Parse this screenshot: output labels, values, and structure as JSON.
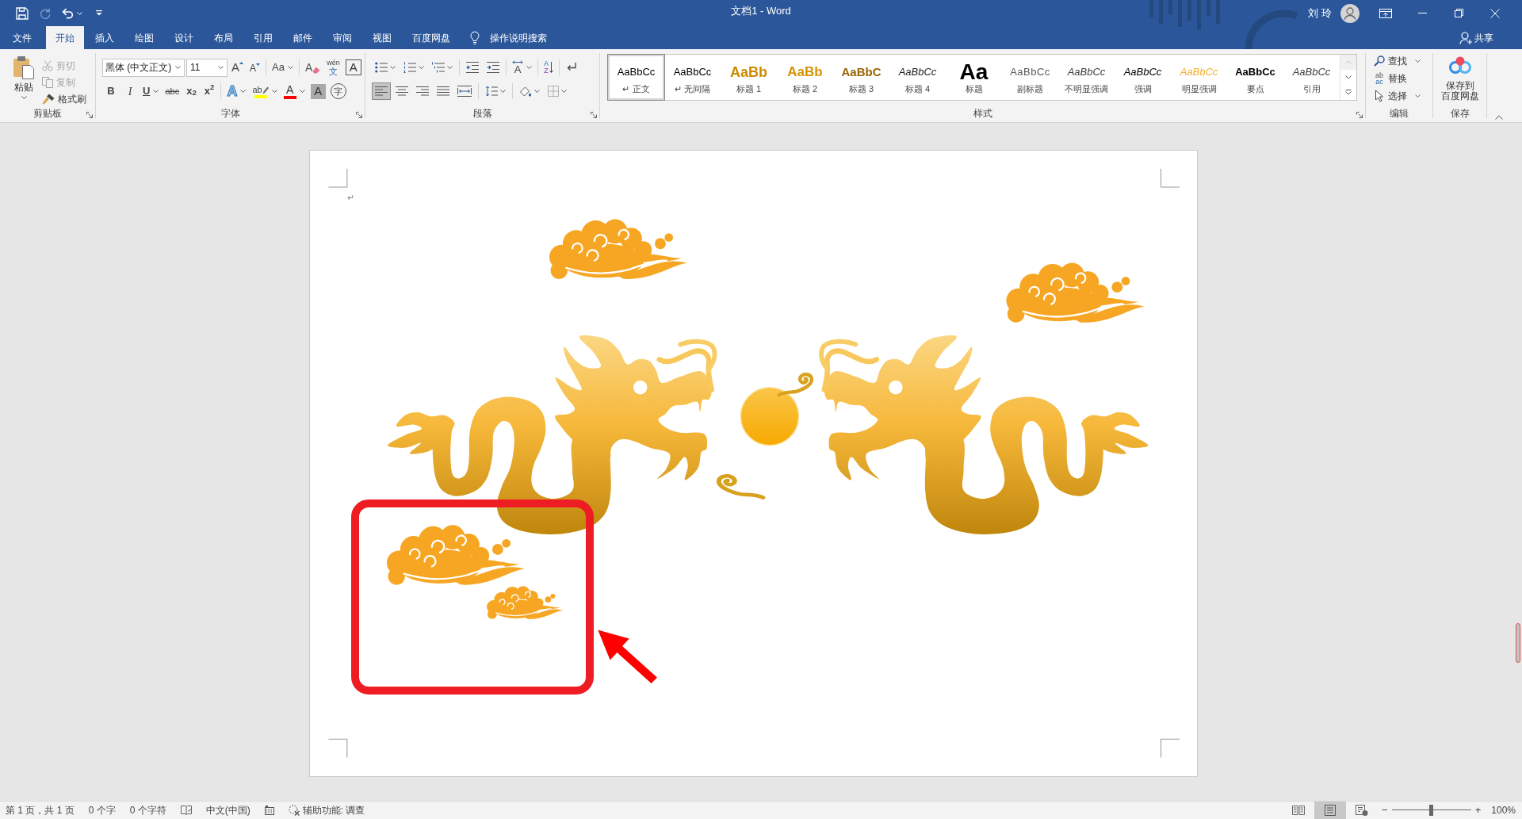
{
  "window": {
    "title": "文档1 - Word",
    "user": "刘 玲"
  },
  "quick_access": [
    {
      "kind": "save",
      "disabled": false
    },
    {
      "kind": "repeat",
      "disabled": true
    },
    {
      "kind": "undo",
      "disabled": false,
      "dropdown": true
    },
    {
      "kind": "customize",
      "disabled": false
    }
  ],
  "tabs": [
    {
      "label": "文件",
      "selected": false
    },
    {
      "label": "开始",
      "selected": true
    },
    {
      "label": "插入",
      "selected": false
    },
    {
      "label": "绘图",
      "selected": false
    },
    {
      "label": "设计",
      "selected": false
    },
    {
      "label": "布局",
      "selected": false
    },
    {
      "label": "引用",
      "selected": false
    },
    {
      "label": "邮件",
      "selected": false
    },
    {
      "label": "审阅",
      "selected": false
    },
    {
      "label": "视图",
      "selected": false
    },
    {
      "label": "百度网盘",
      "selected": false
    }
  ],
  "tell_me": {
    "placeholder": "操作说明搜索"
  },
  "share": {
    "label": "共享"
  },
  "ribbon": {
    "clipboard": {
      "label": "剪贴板",
      "paste": "粘贴",
      "items": [
        {
          "kind": "cut",
          "label": "剪切",
          "disabled": true
        },
        {
          "kind": "copy",
          "label": "复制",
          "disabled": true
        },
        {
          "kind": "format_painter",
          "label": "格式刷",
          "disabled": false
        }
      ]
    },
    "font": {
      "label": "字体",
      "font_name": "黑体 (中文正文)",
      "font_size": "11",
      "row1": [
        [
          {
            "kind": "grow",
            "text": "A"
          },
          {
            "kind": "shrink",
            "text": "A"
          }
        ],
        [
          {
            "kind": "case",
            "text": "Aa",
            "dropdown": true
          }
        ],
        [
          {
            "kind": "clear",
            "text": "A"
          },
          {
            "kind": "phonetic",
            "text": "wén",
            "text2": "文"
          },
          {
            "kind": "border",
            "text": "A"
          }
        ]
      ],
      "row2": [
        [
          {
            "kind": "bold",
            "text": "B"
          },
          {
            "kind": "italic",
            "text": "I"
          },
          {
            "kind": "underline",
            "text": "U",
            "dropdown": true
          },
          {
            "kind": "strike",
            "text": "abc"
          },
          {
            "kind": "subscript",
            "text": "x$_{2}$"
          },
          {
            "kind": "superscript",
            "text": "x$^{2}$"
          }
        ],
        [
          {
            "kind": "effects",
            "text": "A",
            "dropdown": true
          },
          {
            "kind": "highlight",
            "text": "ab",
            "dropdown": true,
            "color": "#ffff00"
          },
          {
            "kind": "color",
            "text": "A",
            "dropdown": true,
            "color": "#ff0000"
          },
          {
            "kind": "shading",
            "text": "A"
          },
          {
            "kind": "enclose",
            "text": "字"
          }
        ]
      ]
    },
    "paragraph": {
      "label": "段落",
      "row1": [
        [
          {
            "kind": "bullets",
            "dropdown": true
          },
          {
            "kind": "numbering",
            "dropdown": true
          },
          {
            "kind": "multilevel",
            "dropdown": true
          }
        ],
        [
          {
            "kind": "outdent"
          },
          {
            "kind": "indent"
          }
        ],
        [
          {
            "kind": "asian_layout",
            "text": "A",
            "dropdown": true
          }
        ],
        [
          {
            "kind": "sort",
            "text": "A",
            "text2": "Z"
          }
        ],
        [
          {
            "kind": "show_marks"
          }
        ]
      ],
      "row2": [
        [
          {
            "kind": "align_left",
            "selected": true
          },
          {
            "kind": "align_center",
            "selected": false
          },
          {
            "kind": "align_right",
            "selected": false
          },
          {
            "kind": "justify",
            "selected": false
          },
          {
            "kind": "distribute",
            "selected": false
          }
        ],
        [
          {
            "kind": "line_spacing",
            "dropdown": true
          }
        ],
        [
          {
            "kind": "shading",
            "dropdown": true
          },
          {
            "kind": "borders",
            "dropdown": true
          }
        ]
      ]
    },
    "styles": {
      "label": "样式",
      "items": [
        {
          "kind": "normal",
          "preview": "AaBbCc",
          "label": "↵ 正文",
          "selected": true
        },
        {
          "kind": "no_spacing",
          "preview": "AaBbCc",
          "label": "↵ 无间隔",
          "selected": false
        },
        {
          "kind": "heading1",
          "preview": "AaBb",
          "label": "标题 1",
          "selected": false
        },
        {
          "kind": "heading2",
          "preview": "AaBb",
          "label": "标题 2",
          "selected": false
        },
        {
          "kind": "heading3",
          "preview": "AaBbC",
          "label": "标题 3",
          "selected": false
        },
        {
          "kind": "heading4",
          "preview": "AaBbCc",
          "label": "标题 4",
          "selected": false
        },
        {
          "kind": "title",
          "preview": "Aa",
          "label": "标题",
          "selected": false
        },
        {
          "kind": "subtitle",
          "preview": "AaBbCc",
          "label": "副标题",
          "selected": false
        },
        {
          "kind": "subtle_emphasis",
          "preview": "AaBbCc",
          "label": "不明显强调",
          "selected": false
        },
        {
          "kind": "emphasis",
          "preview": "AaBbCc",
          "label": "强调",
          "selected": false
        },
        {
          "kind": "intense_emphasis",
          "preview": "AaBbCc",
          "label": "明显强调",
          "selected": false
        },
        {
          "kind": "strong",
          "preview": "AaBbCc",
          "label": "要点",
          "selected": false
        },
        {
          "kind": "quote",
          "preview": "AaBbCc",
          "label": "引用",
          "selected": false
        }
      ]
    },
    "editing": {
      "label": "编辑",
      "items": [
        {
          "kind": "find",
          "label": "查找",
          "dropdown": true
        },
        {
          "kind": "replace",
          "label": "替换",
          "text": "ab",
          "text2": "ac"
        },
        {
          "kind": "select",
          "label": "选择",
          "dropdown": true
        }
      ]
    },
    "save": {
      "label": "保存",
      "button_lines": [
        "保存到",
        "百度网盘"
      ]
    }
  },
  "document": {
    "paragraph_mark": "↵",
    "artwork": [
      {
        "kind": "cloud"
      },
      {
        "kind": "cloud"
      },
      {
        "kind": "dragon"
      },
      {
        "kind": "pearl"
      },
      {
        "kind": "swirl"
      },
      {
        "kind": "swirl"
      },
      {
        "kind": "dragon"
      },
      {
        "kind": "cloud"
      },
      {
        "kind": "cloud"
      }
    ],
    "annotations": [
      {
        "kind": "frame"
      },
      {
        "kind": "arrow"
      }
    ]
  },
  "status_bar": {
    "left": [
      {
        "kind": "text",
        "label": "第 1 页，共 1 页"
      },
      {
        "kind": "text",
        "label": "0 个字"
      },
      {
        "kind": "text",
        "label": "0 个字符"
      },
      {
        "kind": "proofing"
      },
      {
        "kind": "text",
        "label": "中文(中国)"
      },
      {
        "kind": "macro"
      },
      {
        "kind": "accessibility",
        "label": "辅助功能: 调查"
      }
    ],
    "views": [
      {
        "kind": "read",
        "selected": false
      },
      {
        "kind": "print",
        "selected": true
      },
      {
        "kind": "web",
        "selected": false
      }
    ],
    "zoom": {
      "minus": "−",
      "plus": "+",
      "level": 0.5,
      "label": "100%"
    }
  }
}
